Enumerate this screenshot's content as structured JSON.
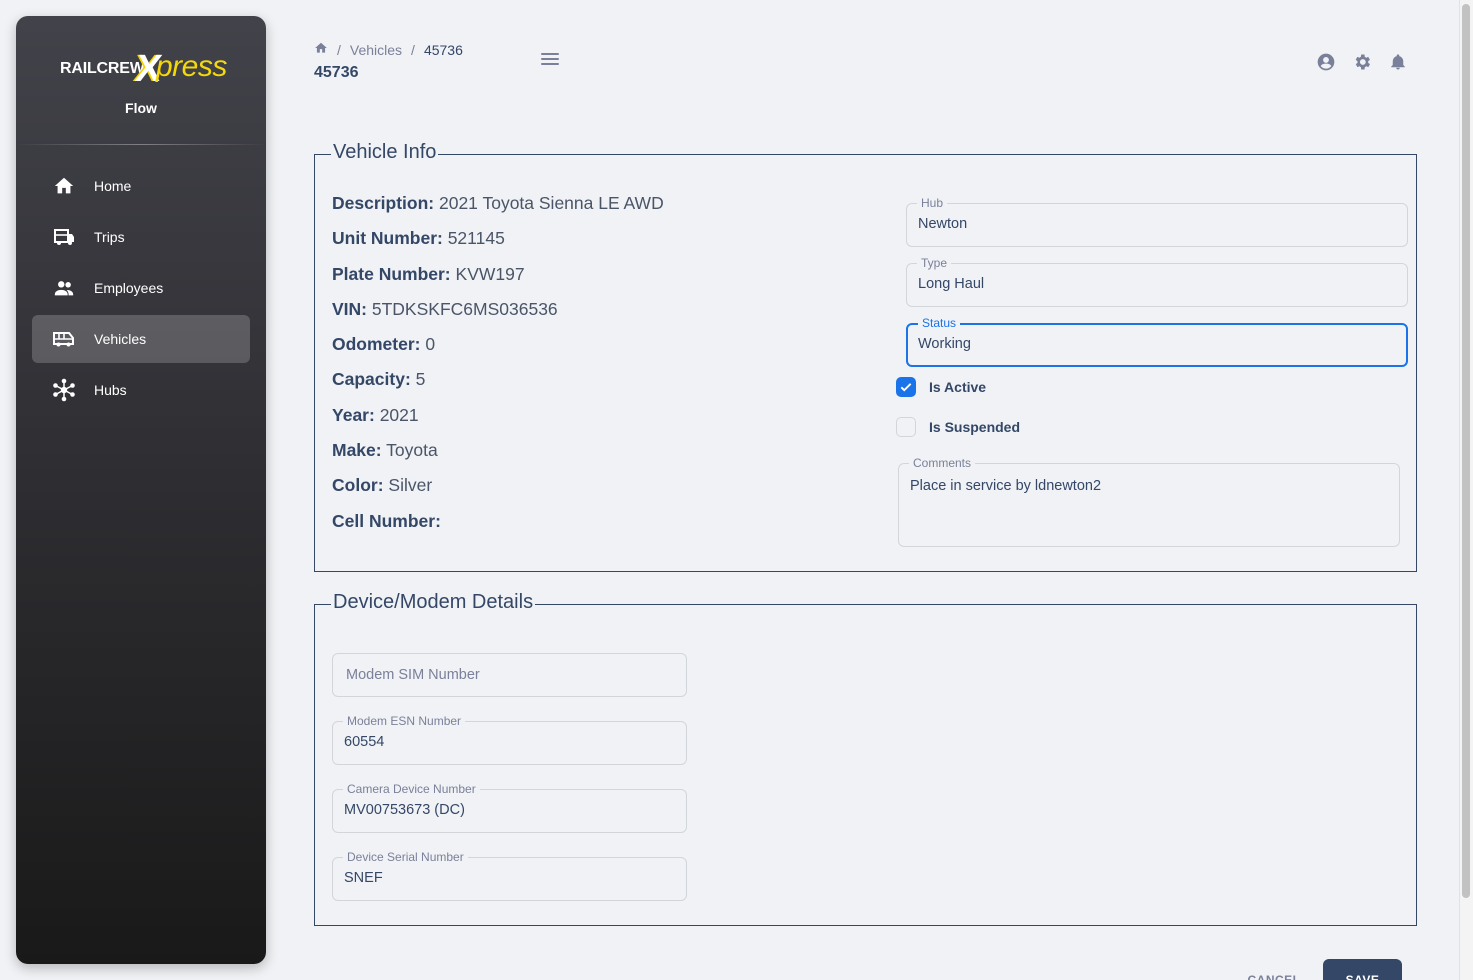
{
  "brand": {
    "logo_rail": "RAILCREW",
    "logo_x": "X",
    "logo_press": "press",
    "subtitle": "Flow"
  },
  "sidebar": {
    "items": [
      {
        "label": "Home",
        "icon": "home-icon",
        "active": false
      },
      {
        "label": "Trips",
        "icon": "bus-icon",
        "active": false
      },
      {
        "label": "Employees",
        "icon": "people-icon",
        "active": false
      },
      {
        "label": "Vehicles",
        "icon": "van-icon",
        "active": true
      },
      {
        "label": "Hubs",
        "icon": "hub-network-icon",
        "active": false
      }
    ]
  },
  "header": {
    "breadcrumb": [
      "Vehicles",
      "45736"
    ],
    "title": "45736"
  },
  "vehicle_info": {
    "legend": "Vehicle Info",
    "rows": [
      {
        "label": "Description:",
        "value": "2021 Toyota Sienna LE AWD"
      },
      {
        "label": "Unit Number:",
        "value": "521145"
      },
      {
        "label": "Plate Number:",
        "value": "KVW197"
      },
      {
        "label": "VIN:",
        "value": "5TDKSKFC6MS036536"
      },
      {
        "label": "Odometer:",
        "value": "0"
      },
      {
        "label": "Capacity:",
        "value": "5"
      },
      {
        "label": "Year:",
        "value": "2021"
      },
      {
        "label": "Make:",
        "value": "Toyota"
      },
      {
        "label": "Color:",
        "value": "Silver"
      },
      {
        "label": "Cell Number:",
        "value": ""
      }
    ],
    "hub": {
      "label": "Hub",
      "value": "Newton"
    },
    "type": {
      "label": "Type",
      "value": "Long Haul"
    },
    "status": {
      "label": "Status",
      "value": "Working"
    },
    "is_active": {
      "label": "Is Active",
      "checked": true
    },
    "is_suspended": {
      "label": "Is Suspended",
      "checked": false
    },
    "comments": {
      "label": "Comments",
      "value": "Place in service by ldnewton2"
    }
  },
  "device": {
    "legend": "Device/Modem Details",
    "modem_sim": {
      "placeholder": "Modem SIM Number",
      "value": ""
    },
    "modem_esn": {
      "label": "Modem ESN Number",
      "value": "60554"
    },
    "camera": {
      "label": "Camera Device Number",
      "value": "MV00753673 (DC)"
    },
    "serial": {
      "label": "Device Serial Number",
      "value": "SNEF"
    }
  },
  "actions": {
    "cancel": "CANCEL",
    "save": "SAVE"
  },
  "colors": {
    "primary_text": "#344767",
    "secondary_text": "#7b809a",
    "focus_blue": "#1a73e8",
    "logo_yellow": "#f5d80a"
  }
}
